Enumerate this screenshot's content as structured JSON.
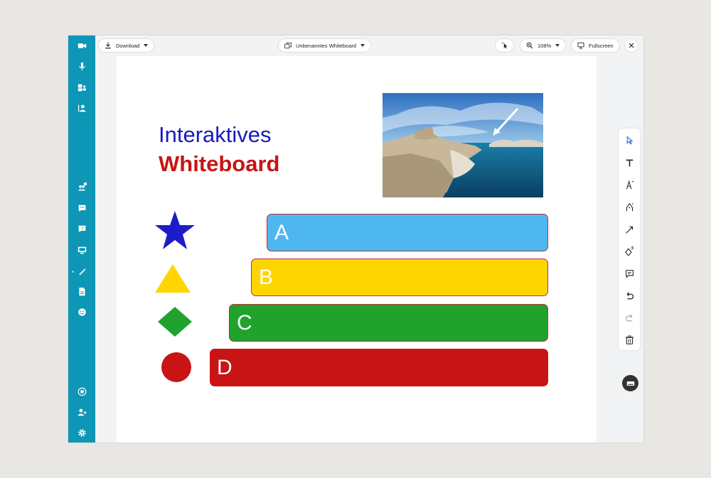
{
  "topbar": {
    "download_label": "Download",
    "board_name": "Unbenanntes Whiteboard",
    "zoom": "108%",
    "fullscreen_label": "Fullscreen"
  },
  "board": {
    "title_line1": "Interaktives",
    "title_line2": "Whiteboard",
    "bars": [
      {
        "label": "A",
        "color": "#4fb7f0"
      },
      {
        "label": "B",
        "color": "#ffd500"
      },
      {
        "label": "C",
        "color": "#1fa32c"
      },
      {
        "label": "D",
        "color": "#c81414"
      }
    ],
    "shape_colors": {
      "star": "#1c1cc8",
      "triangle": "#ffd500",
      "diamond": "#1fa32c",
      "circle": "#c81414"
    }
  },
  "colors": {
    "sidebar": "#0d96b5",
    "accent": "#2e6de0"
  },
  "icons": {
    "left_sidebar": [
      "video-icon",
      "microphone-icon",
      "screen-share-icon",
      "participant-icon",
      "participants-count-icon",
      "chat-icon",
      "question-icon",
      "presentation-icon",
      "whiteboard-icon",
      "document-icon",
      "emoji-icon",
      "record-icon",
      "add-user-icon",
      "settings-icon"
    ],
    "right_tools": [
      "select-icon",
      "text-icon",
      "font-size-icon",
      "pen-icon",
      "arrow-icon",
      "shape-icon",
      "comment-icon",
      "undo-icon",
      "redo-icon",
      "trash-icon"
    ]
  }
}
